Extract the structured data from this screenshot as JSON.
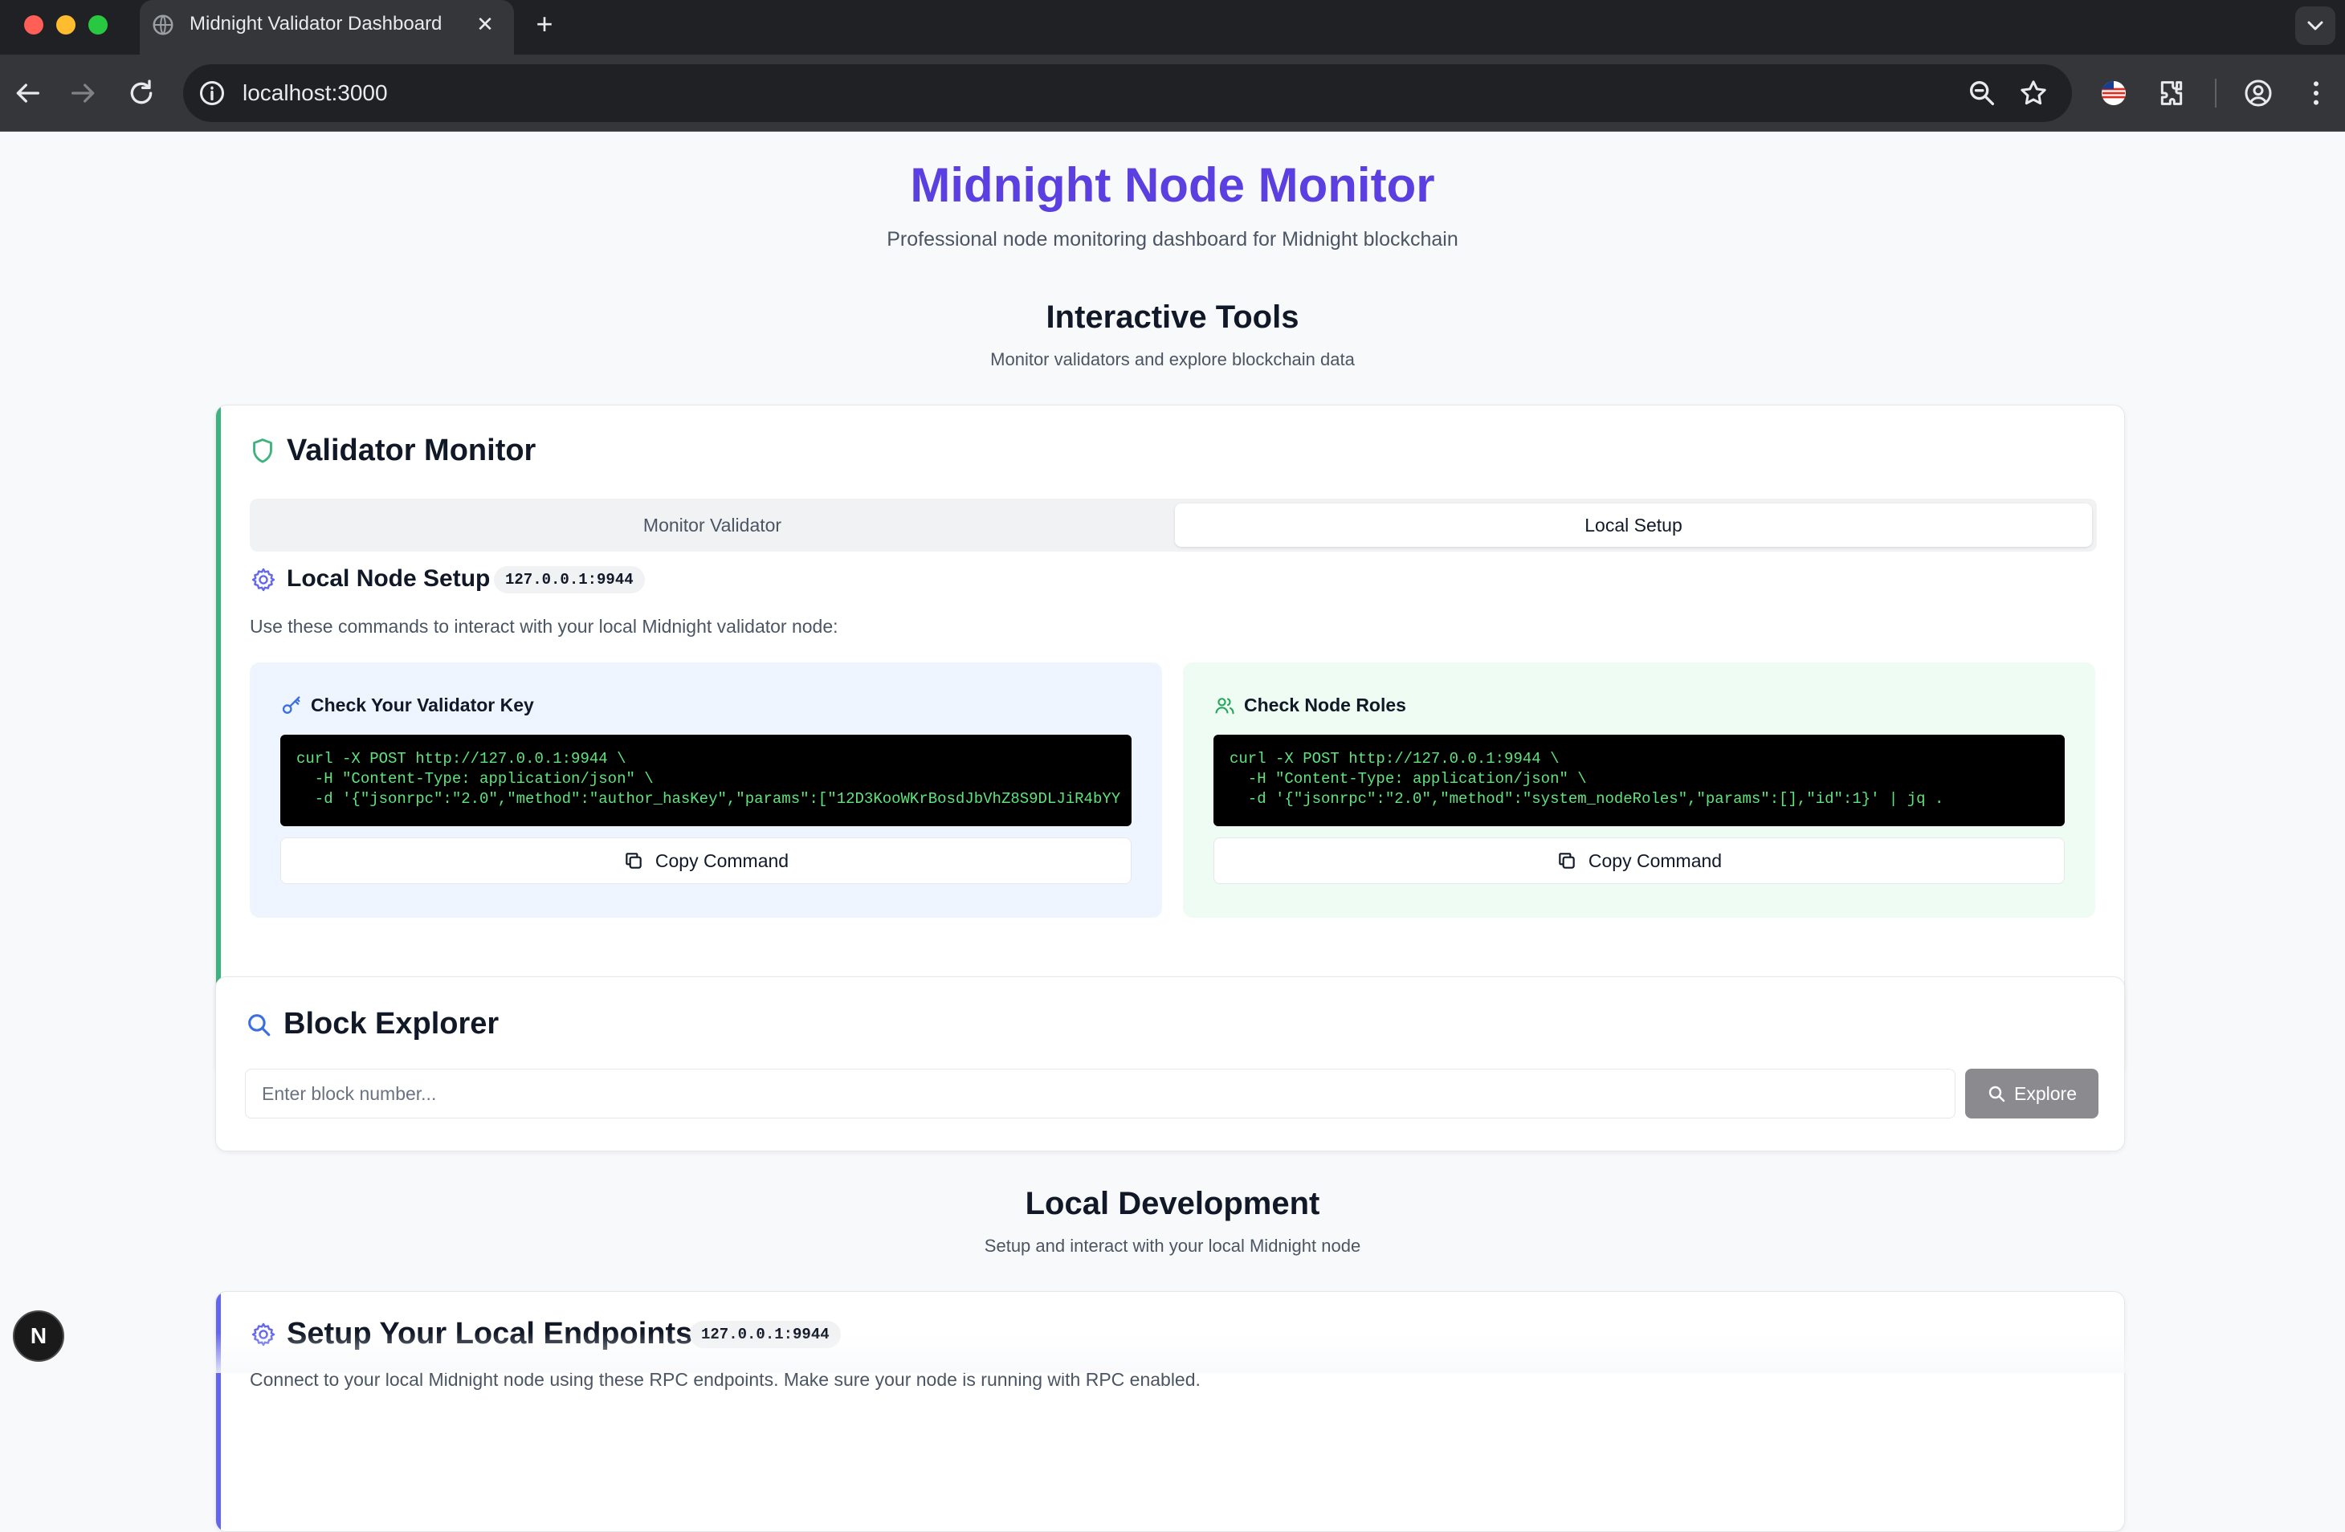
{
  "browser": {
    "tab_title": "Midnight Validator Dashboard",
    "tab_close": "✕",
    "new_tab": "+",
    "url": "localhost:3000"
  },
  "hero": {
    "title": "Midnight Node Monitor",
    "subtitle": "Professional node monitoring dashboard for Midnight blockchain"
  },
  "interactive_tools": {
    "title": "Interactive Tools",
    "subtitle": "Monitor validators and explore blockchain data"
  },
  "validator_monitor": {
    "title": "Validator Monitor",
    "tabs": [
      {
        "label": "Monitor Validator",
        "active": false
      },
      {
        "label": "Local Setup",
        "active": true
      }
    ],
    "local_setup": {
      "title": "Local Node Setup",
      "badge": "127.0.0.1:9944",
      "description": "Use these commands to interact with your local Midnight validator node:",
      "panels": [
        {
          "title": "Check Your Validator Key",
          "icon": "key-icon",
          "color": "#eff5ff",
          "code_lines": [
            "curl -X POST http://127.0.0.1:9944 \\",
            "  -H \"Content-Type: application/json\" \\",
            "  -d '{\"jsonrpc\":\"2.0\",\"method\":\"author_hasKey\",\"params\":[\"12D3KooWKrBosdJbVhZ8S9DLJiR4bYY"
          ],
          "button": "Copy Command"
        },
        {
          "title": "Check Node Roles",
          "icon": "users-icon",
          "color": "#effcf3",
          "code_lines": [
            "curl -X POST http://127.0.0.1:9944 \\",
            "  -H \"Content-Type: application/json\" \\",
            "  -d '{\"jsonrpc\":\"2.0\",\"method\":\"system_nodeRoles\",\"params\":[],\"id\":1}' | jq ."
          ],
          "button": "Copy Command"
        }
      ]
    }
  },
  "block_explorer": {
    "title": "Block Explorer",
    "input_value": "",
    "input_placeholder": "Enter block number...",
    "button": "Explore"
  },
  "local_development": {
    "title": "Local Development",
    "subtitle": "Setup and interact with your local Midnight node",
    "card_title": "Setup Your Local Endpoints",
    "card_badge": "127.0.0.1:9944",
    "card_description": "Connect to your local Midnight node using these RPC endpoints. Make sure your node is running with RPC enabled."
  },
  "fab_label": "N",
  "colors": {
    "brand": "#5b3fe0",
    "validator_accent": "#3fb37f",
    "dev_accent": "#6366f1",
    "code_text": "#5ee37d"
  }
}
